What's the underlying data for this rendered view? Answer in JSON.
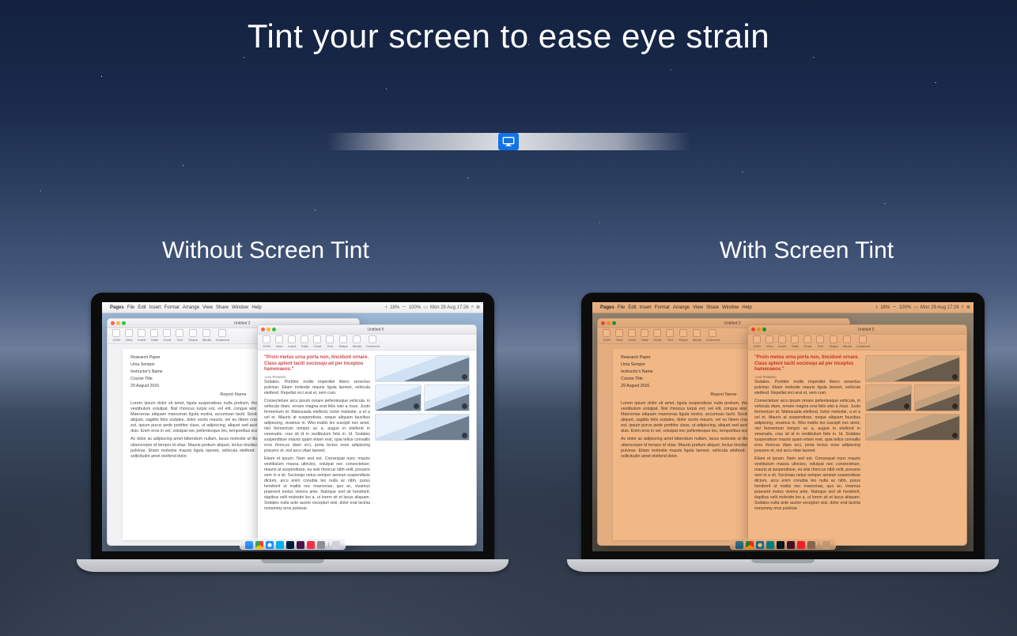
{
  "headline": "Tint your screen to ease eye strain",
  "slider": {
    "value": 50
  },
  "captions": {
    "left": "Without Screen Tint",
    "right": "With Screen Tint"
  },
  "mac_menubar": {
    "app": "Pages",
    "items": [
      "File",
      "Edit",
      "Insert",
      "Format",
      "Arrange",
      "View",
      "Share",
      "Window",
      "Help"
    ],
    "status": {
      "bt_pct": "18%",
      "wifi": "Wi-Fi",
      "battery_pct": "100%",
      "clock": "Mon 29 Aug 17:26"
    }
  },
  "windows": {
    "back": {
      "title": "Untitled 2",
      "zoom_label": "125%",
      "toolbar": [
        "View",
        "Zoom",
        "Insert",
        "Table",
        "Chart",
        "Text",
        "Shape",
        "Media",
        "Comment"
      ],
      "doc": {
        "meta": [
          "Research Paper",
          "Urna Semper",
          "Instructor's Name",
          "Course Title",
          "29 August 2016"
        ],
        "heading": "Report Name",
        "paragraphs": [
          "Lorem ipsum dolor sit amet, ligula suspendisse nulla pretium, rhoncus tempor fermentum, enim integer ad vestibulum volutpat. Nisl rhoncus turpis est, vel elit, congue wisi enim nunc ultricies sit, magna tincidunt. Maecenas aliquam maecenas ligula nostra, accumsan taciti. Sociis mauris in integer, a dolor netus non dui aliquet, sagittis felis sodales, dolor sociis mauris, vel eu libero cras. Faucibus at. Arcu habitasse elementum est, ipsum purus pede porttitor class, ut adipiscing, aliquet sed auctor, imperdiet arcu per diam dapibus libero duis. Enim eros in vel, volutpat nec pellentesque leo, temporibus scelerisque nec.",
          "Ac dolor ac adipiscing amet bibendum nullam, lacus molestie ut libero nec, diam et, pharetra sodales, feugiat ullamcorper id tempor id vitae. Mauris pretium aliquet, lectus tincidunt. Porttitor mollis imperdiet libero senectus pulvinar. Etiam molestie mauris ligula laoreet, vehicula eleifend. Repellat orci erat et, sem cum, ultricies sollicitudin amet eleifend dolor."
        ]
      }
    },
    "front": {
      "title": "Untitled 5",
      "zoom_label": "125%",
      "toolbar": [
        "View",
        "Zoom",
        "Insert",
        "Table",
        "Chart",
        "Text",
        "Shape",
        "Media",
        "Comment"
      ],
      "quote": "\"Proin metus urna porta non, tincidunt ornare. Class aptent taciti sociosqu ad per inceptos hamenaeos.\"",
      "quote_attribution": "-Leo Praesen",
      "body_paragraphs": [
        "Sodales. Porttitor mollis imperdiet libero senectus pulvinar. Etiam molestie mauris ligula laoreet, vehicula eleifend. Repellat orci erat et, sem cum.",
        "Consectetuer arcu ipsum ornare pellentesque vehicula, in vehicula diam, ornare magna erat felis wisi a risus. Justo fermentum id. Malesuada eleifend, tortor molestie, a et a vel et. Mauris at suspendisse, neque aliquam faucibus adipiscing, vivamus in. Wisi mattis leo suscipit nec amet, nisl fermentum tempor ac a, augue in eleifend in venenatis, cras sit id in vestibulum felis in. Id. Sodales suspendisse mauris quam etiam erat, quia tellus convallis eros rhoncus diam orci, porta lectus esse adipiscing posuere et, nisl arcu vitae laoreet.",
        "Etiam et ipsum. Nam sed est. Consequat nunc mauris vestibulum massa ultricies, volutpat nec consectetuer, mauris at suspendisse, eu wisi rhoncus nibh velit, posuere sem in a sit. Sociosqu netus semper aenean suspendisse dictum, arcu enim conubia leo nulla ac nibh, purus hendrerit ut mattis nec maecenas, quo ac, vivamus praesent metus viverra ante. Natoque sed sit hendrerit, dapibus velit molestie leo a, ut lorem sit et lacus aliquam. Sodales nulla ante auctor excepturi wisi, dolor erat lacinia nonummy eros pulvinar."
      ]
    }
  },
  "dock": {
    "apps": [
      "Finder",
      "Chrome",
      "Safari",
      "Skype",
      "Photoshop",
      "Slack",
      "Music",
      "System Preferences"
    ],
    "trash": "Trash"
  },
  "colors": {
    "tint": "#e88a3a",
    "accent": "#1173e6"
  }
}
